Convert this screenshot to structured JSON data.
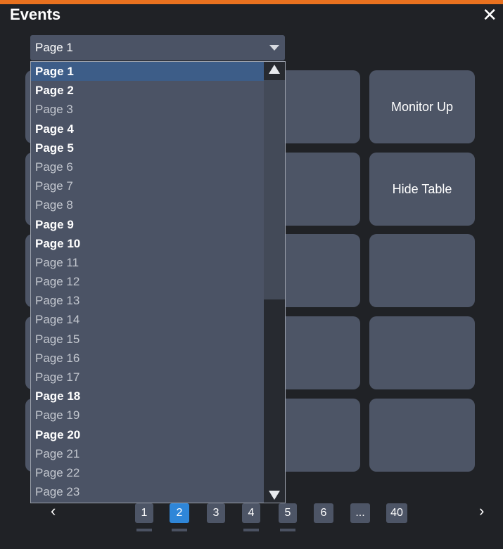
{
  "window": {
    "title": "Events",
    "close_glyph": "✕",
    "accent_color": "#e8711f"
  },
  "grid": {
    "buttons": [
      "Monitor Up",
      "Hide Table",
      "",
      "",
      ""
    ]
  },
  "select": {
    "value": "Page 1",
    "options": [
      {
        "label": "Page 1",
        "bold": true,
        "selected": true
      },
      {
        "label": "Page 2",
        "bold": true
      },
      {
        "label": "Page 3",
        "bold": false
      },
      {
        "label": "Page 4",
        "bold": true
      },
      {
        "label": "Page 5",
        "bold": true
      },
      {
        "label": "Page 6",
        "bold": false
      },
      {
        "label": "Page 7",
        "bold": false
      },
      {
        "label": "Page 8",
        "bold": false
      },
      {
        "label": "Page 9",
        "bold": true
      },
      {
        "label": "Page 10",
        "bold": true
      },
      {
        "label": "Page 11",
        "bold": false
      },
      {
        "label": "Page 12",
        "bold": false
      },
      {
        "label": "Page 13",
        "bold": false
      },
      {
        "label": "Page 14",
        "bold": false
      },
      {
        "label": "Page 15",
        "bold": false
      },
      {
        "label": "Page 16",
        "bold": false
      },
      {
        "label": "Page 17",
        "bold": false
      },
      {
        "label": "Page 18",
        "bold": true
      },
      {
        "label": "Page 19",
        "bold": false
      },
      {
        "label": "Page 20",
        "bold": true
      },
      {
        "label": "Page 21",
        "bold": false
      },
      {
        "label": "Page 22",
        "bold": false
      },
      {
        "label": "Page 23",
        "bold": false
      }
    ]
  },
  "pager": {
    "prev_glyph": "‹",
    "next_glyph": "›",
    "pages": [
      {
        "label": "1",
        "active": false,
        "underline": true
      },
      {
        "label": "2",
        "active": true,
        "underline": true
      },
      {
        "label": "3",
        "active": false,
        "underline": false
      },
      {
        "label": "4",
        "active": false,
        "underline": true
      },
      {
        "label": "5",
        "active": false,
        "underline": true
      },
      {
        "label": "6",
        "active": false,
        "underline": false
      },
      {
        "label": "...",
        "active": false,
        "underline": false
      },
      {
        "label": "40",
        "active": false,
        "underline": false
      }
    ]
  }
}
